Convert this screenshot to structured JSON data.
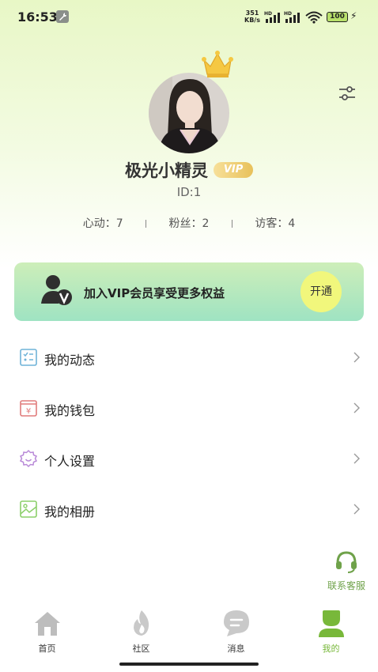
{
  "status_bar": {
    "time": "16:53",
    "net_speed_value": "351",
    "net_speed_unit": "KB/s",
    "signal1_label": "HD",
    "signal2_label": "HD",
    "battery": "100"
  },
  "profile": {
    "username": "极光小精灵",
    "vip_badge": "VIP",
    "user_id": "ID:1",
    "stats": {
      "likes": "心动：7",
      "fans": "粉丝：2",
      "visitors": "访客：4"
    }
  },
  "vip_banner": {
    "text": "加入VIP会员享受更多权益",
    "button": "开通"
  },
  "menu": {
    "items": [
      {
        "label": "我的动态",
        "icon": "list-icon"
      },
      {
        "label": "我的钱包",
        "icon": "wallet-icon"
      },
      {
        "label": "个人设置",
        "icon": "settings-gear-icon"
      },
      {
        "label": "我的相册",
        "icon": "photo-icon"
      }
    ]
  },
  "service": {
    "label": "联系客服"
  },
  "tabbar": {
    "tabs": [
      {
        "label": "首页",
        "icon": "home-icon"
      },
      {
        "label": "社区",
        "icon": "fire-icon"
      },
      {
        "label": "消息",
        "icon": "chat-icon"
      },
      {
        "label": "我的",
        "icon": "user-icon"
      }
    ],
    "active_index": 3
  },
  "colors": {
    "accent_green": "#78b83a",
    "vip_gold": "#e8c15a",
    "banner_start": "#cdeeb9",
    "banner_end": "#9fe3c2",
    "open_button": "#f1f77c"
  }
}
